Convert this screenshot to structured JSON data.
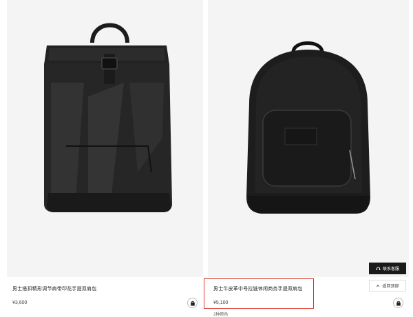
{
  "products": [
    {
      "name": "男士搭扣精形调节肩带印花手提双肩包",
      "price": "¥3,600",
      "icon": "shopping-bag-icon"
    },
    {
      "name": "男士牛皮革中号拉链休闲商务手提双肩包",
      "price": "¥5,100",
      "colors": "2种颜色",
      "icon": "shopping-bag-icon"
    }
  ],
  "floating": {
    "contact_label": "联系客服",
    "top_label": "返回顶部"
  },
  "colors": {
    "highlight": "#d9342b",
    "image_bg": "#f4f4f4",
    "contact_bg": "#1a1a1a"
  }
}
